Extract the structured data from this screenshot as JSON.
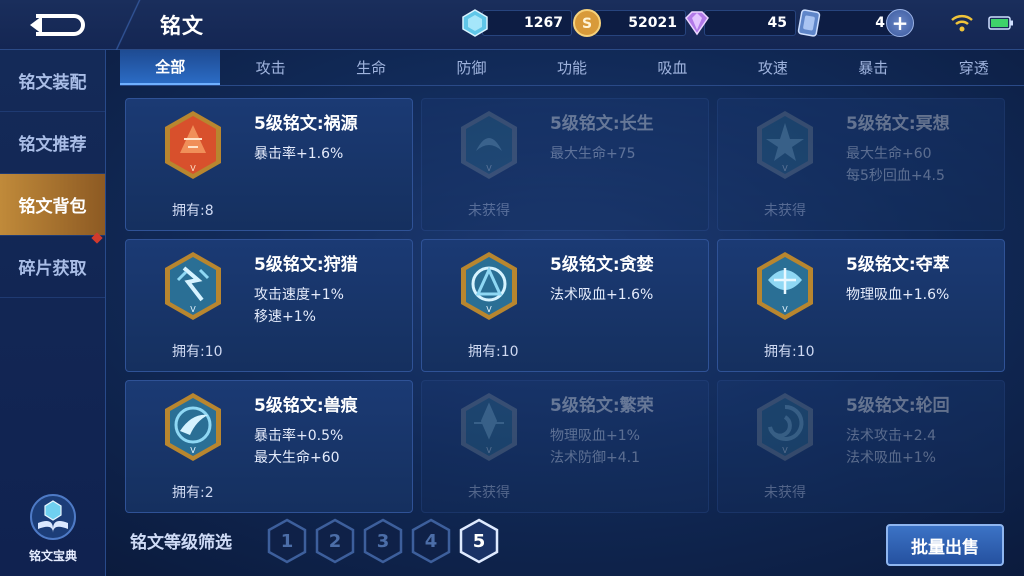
{
  "header": {
    "title": "铭文",
    "currencies": [
      {
        "icon": "crystal-gem-icon",
        "value": "1267"
      },
      {
        "icon": "gold-coin-icon",
        "value": "52021"
      },
      {
        "icon": "purple-diamond-icon",
        "value": "45"
      },
      {
        "icon": "ticket-card-icon",
        "value": "4"
      }
    ]
  },
  "sidebar": {
    "items": [
      {
        "label": "铭文装配"
      },
      {
        "label": "铭文推荐"
      },
      {
        "label": "铭文背包"
      },
      {
        "label": "碎片获取"
      }
    ],
    "codex_label": "铭文宝典"
  },
  "tabs": [
    {
      "label": "全部"
    },
    {
      "label": "攻击"
    },
    {
      "label": "生命"
    },
    {
      "label": "防御"
    },
    {
      "label": "功能"
    },
    {
      "label": "吸血"
    },
    {
      "label": "攻速"
    },
    {
      "label": "暴击"
    },
    {
      "label": "穿透"
    }
  ],
  "cards": [
    {
      "name": "5级铭文:祸源",
      "stats": [
        "暴击率+1.6%"
      ],
      "own": "拥有:8",
      "color": "#d84a2a"
    },
    {
      "name": "5级铭文:长生",
      "stats": [
        "最大生命+75"
      ],
      "own": "未获得",
      "color": "#3a8fb0"
    },
    {
      "name": "5级铭文:冥想",
      "stats": [
        "最大生命+60",
        "每5秒回血+4.5"
      ],
      "own": "未获得",
      "color": "#3a8fb0"
    },
    {
      "name": "5级铭文:狩猎",
      "stats": [
        "攻击速度+1%",
        "移速+1%"
      ],
      "own": "拥有:10",
      "color": "#3ba6c9"
    },
    {
      "name": "5级铭文:贪婪",
      "stats": [
        "法术吸血+1.6%"
      ],
      "own": "拥有:10",
      "color": "#3ba6c9"
    },
    {
      "name": "5级铭文:夺萃",
      "stats": [
        "物理吸血+1.6%"
      ],
      "own": "拥有:10",
      "color": "#3ba6c9"
    },
    {
      "name": "5级铭文:兽痕",
      "stats": [
        "暴击率+0.5%",
        "最大生命+60"
      ],
      "own": "拥有:2",
      "color": "#3ba6c9"
    },
    {
      "name": "5级铭文:繁荣",
      "stats": [
        "物理吸血+1%",
        "法术防御+4.1"
      ],
      "own": "未获得",
      "color": "#3a8fb0"
    },
    {
      "name": "5级铭文:轮回",
      "stats": [
        "法术攻击+2.4",
        "法术吸血+1%"
      ],
      "own": "未获得",
      "color": "#3a8fb0"
    }
  ],
  "bottom": {
    "filter_label": "铭文等级筛选",
    "levels": [
      "1",
      "2",
      "3",
      "4",
      "5"
    ],
    "selected_level": "5",
    "sell_label": "批量出售"
  }
}
